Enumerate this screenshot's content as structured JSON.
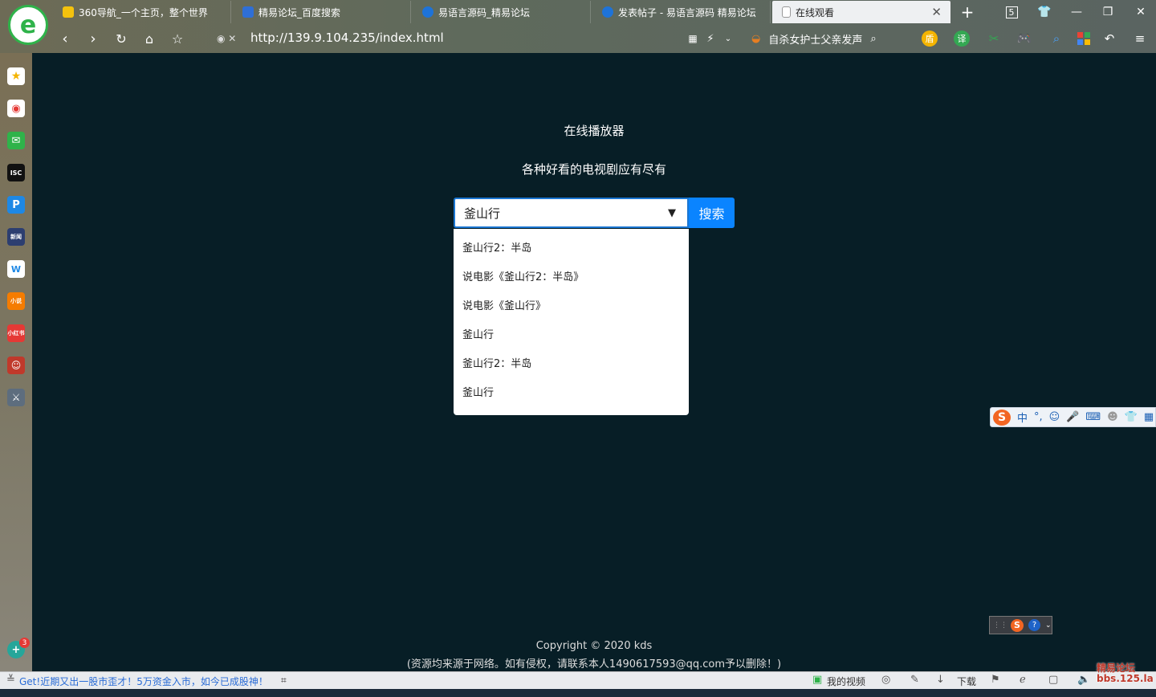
{
  "browser": {
    "tabs": [
      {
        "title": "360导航_一个主页，整个世界",
        "color": "#f4c20d"
      },
      {
        "title": "精易论坛_百度搜索",
        "color": "#2f6fd6"
      },
      {
        "title": "易语言源码_精易论坛",
        "color": "#1e73d8"
      },
      {
        "title": "发表帖子 - 易语言源码 精易论坛",
        "color": "#1e73d8"
      },
      {
        "title": "在线观看",
        "color": "#ffffff"
      }
    ],
    "tab_count": "5",
    "url": "http://139.9.104.235/index.html",
    "hot_search": "自杀女护士父亲发声"
  },
  "page": {
    "title": "在线播放器",
    "subtitle": "各种好看的电视剧应有尽有",
    "search_value": "釜山行",
    "search_button": "搜索",
    "suggestions": [
      "釜山行2：半岛",
      "说电影《釜山行2：半岛》",
      "说电影《釜山行》",
      "釜山行",
      "釜山行2：半岛",
      "釜山行"
    ],
    "copyright": "Copyright © 2020 kds",
    "disclaimer": "(资源均来源于网络。如有侵权，请联系本人1490617593@qq.com予以删除！)"
  },
  "ime": {
    "mode": "中"
  },
  "status_bar": {
    "ticker": "Get!近期又出一股市歪才！5万资金入市，如今已成股神！",
    "my_video": "我的视频",
    "download": "下载"
  },
  "sidebar_badge": "3",
  "watermark": "精易论坛 bbs.125.la",
  "colors": {
    "page_bg": "#071e26",
    "accent": "#0a84ff"
  }
}
